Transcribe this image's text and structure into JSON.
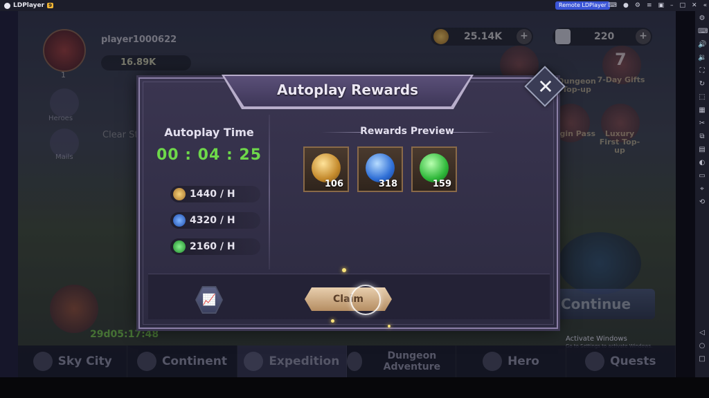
{
  "emulator": {
    "app_name": "LDPlayer",
    "version_badge": "9",
    "remote_label": "Remote LDPlayer"
  },
  "game": {
    "player_name": "player1000622",
    "power": "16.89K",
    "level": "1",
    "gold": "25.14K",
    "gems": "220",
    "side_buttons": [
      "Heroes",
      "Mails"
    ],
    "events": [
      "Dungeon Top-up",
      "7-Day Gifts",
      "Login Pass",
      "Luxury First Top-up"
    ],
    "seven_badge": "7",
    "clear_stage": "Clear St",
    "timer": "29d05:17:48",
    "continue_label": "Continue",
    "watermark_title": "Activate Windows",
    "watermark_sub": "Go to Settings to activate Windows.",
    "nav": [
      "Sky City",
      "Continent",
      "Expedition",
      "Dungeon Adventure",
      "Hero",
      "Quests"
    ]
  },
  "modal": {
    "title": "Autoplay Rewards",
    "autoplay_label": "Autoplay Time",
    "autoplay_time": "00 : 04 : 25",
    "rates": [
      {
        "icon": "gold-coin-icon",
        "value": "1440 / H",
        "color": "#d9a441"
      },
      {
        "icon": "blue-orb-icon",
        "value": "4320 / H",
        "color": "#3a7fe0"
      },
      {
        "icon": "exp-orb-icon",
        "value": "2160 / H",
        "color": "#3cc24a"
      }
    ],
    "rewards_label": "Rewards Preview",
    "rewards": [
      {
        "icon": "gold-medal-icon",
        "count": "106",
        "color": "#d9a441"
      },
      {
        "icon": "blue-orb-icon",
        "count": "318",
        "color": "#3a7fe0"
      },
      {
        "icon": "exp-orb-icon",
        "count": "159",
        "color": "#3cc24a"
      }
    ],
    "claim_label": "Claim"
  }
}
